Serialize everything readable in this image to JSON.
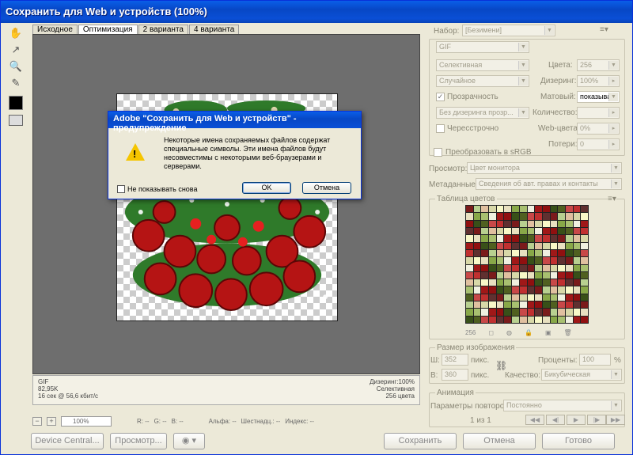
{
  "window": {
    "title": "Сохранить для Web и устройств (100%)"
  },
  "tabs": [
    "Исходное",
    "Оптимизация",
    "2 варианта",
    "4 варианта"
  ],
  "preview_info": {
    "left": [
      "GIF",
      "82,95K",
      "16 сек @ 56,6 кбит/с"
    ],
    "right": [
      "Дизеринг:100%",
      "Селективная",
      "256 цвета"
    ]
  },
  "status": {
    "zoom": "100%",
    "r": "R: --",
    "g": "G: --",
    "b": "B: --",
    "alpha": "Альфа: --",
    "hex": "Шестнадц.: --",
    "index": "Индекс: --"
  },
  "buttons": {
    "device_central": "Device Central...",
    "preview": "Просмотр...",
    "save": "Сохранить",
    "cancel": "Отмена",
    "done": "Готово"
  },
  "settings": {
    "preset_label": "Набор:",
    "preset_value": "[Безимени]",
    "format": "GIF",
    "reduction": "Селективная",
    "dither_algo": "Случайное",
    "transparency": "Прозрачность",
    "trans_dither": "Без дизеринга прозр...",
    "interlaced": "Чересстрочно",
    "colors_label": "Цвета:",
    "colors_value": "256",
    "dither_label": "Дизеринг:",
    "dither_value": "100%",
    "matte_label": "Матовый:",
    "matte_value": "показыва",
    "amount_label": "Количество:",
    "amount_value": "",
    "websnap_label": "Web-цвета:",
    "websnap_value": "0%",
    "lossy_label": "Потери:",
    "lossy_value": "0",
    "srgb": "Преобразовать в sRGB",
    "preview_label": "Просмотр:",
    "preview_value": "Цвет монитора",
    "metadata_label": "Метаданные:",
    "metadata_value": "Сведения об авт. правах и контакты"
  },
  "color_table": {
    "title": "Таблица цветов",
    "count": "256",
    "colors": [
      "#7a1b1b",
      "#a8c070",
      "#c03030",
      "#e8e0c0",
      "#506020",
      "#d8d8a8",
      "#901010",
      "#b8d090",
      "#f0f0e0",
      "#603030",
      "#88a848",
      "#c84848",
      "#f8f8c8",
      "#385018",
      "#e0c0a0",
      "#a01818"
    ]
  },
  "image_size": {
    "title": "Размер изображения",
    "w_label": "Ш:",
    "w_value": "352",
    "h_label": "В:",
    "h_value": "360",
    "unit": "пикс.",
    "percent_label": "Проценты:",
    "percent_value": "100",
    "percent_unit": "%",
    "quality_label": "Качество:",
    "quality_value": "Бикубическая"
  },
  "animation": {
    "title": "Анимация",
    "loop_label": "Параметры повторов:",
    "loop_value": "Постоянно",
    "frame": "1 из 1"
  },
  "dialog": {
    "title": "Adobe \"Сохранить для Web и устройств\" - предупреждение",
    "message": "Некоторые имена сохраняемых файлов содержат специальные символы. Эти имена файлов будут несовместимы с некоторыми веб-браузерами и серверами.",
    "checkbox": "Не показывать снова",
    "ok": "OK",
    "cancel": "Отмена"
  }
}
